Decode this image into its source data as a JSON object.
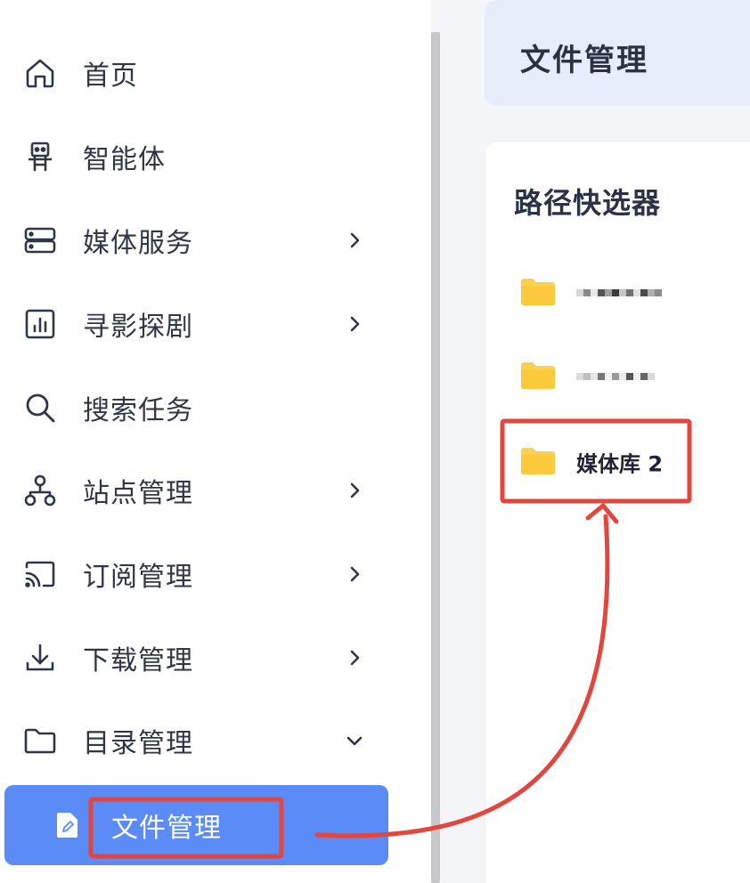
{
  "sidebar": {
    "items": [
      {
        "label": "首页",
        "icon": "home-icon",
        "has_arrow": false
      },
      {
        "label": "智能体",
        "icon": "robot-icon",
        "has_arrow": false
      },
      {
        "label": "媒体服务",
        "icon": "server-icon",
        "has_arrow": true
      },
      {
        "label": "寻影探剧",
        "icon": "chart-icon",
        "has_arrow": true
      },
      {
        "label": "搜索任务",
        "icon": "search-icon",
        "has_arrow": false
      },
      {
        "label": "站点管理",
        "icon": "sitemap-icon",
        "has_arrow": true
      },
      {
        "label": "订阅管理",
        "icon": "cast-icon",
        "has_arrow": true
      },
      {
        "label": "下载管理",
        "icon": "download-icon",
        "has_arrow": true
      },
      {
        "label": "目录管理",
        "icon": "folder-icon",
        "has_arrow": true,
        "expanded": true
      }
    ],
    "active_sub_item": {
      "label": "文件管理",
      "icon": "file-edit-icon"
    }
  },
  "main": {
    "page_title": "文件管理",
    "picker": {
      "title": "路径快选器",
      "folders": [
        {
          "name": "",
          "redacted": true
        },
        {
          "name": "",
          "redacted": true
        },
        {
          "name": "媒体库 2",
          "redacted": false,
          "highlighted": true
        }
      ]
    }
  },
  "colors": {
    "active_bg": "#5b8bf7",
    "header_bg": "#e8edfc",
    "folder": "#fcd04f",
    "annotation": "#e2463f"
  }
}
